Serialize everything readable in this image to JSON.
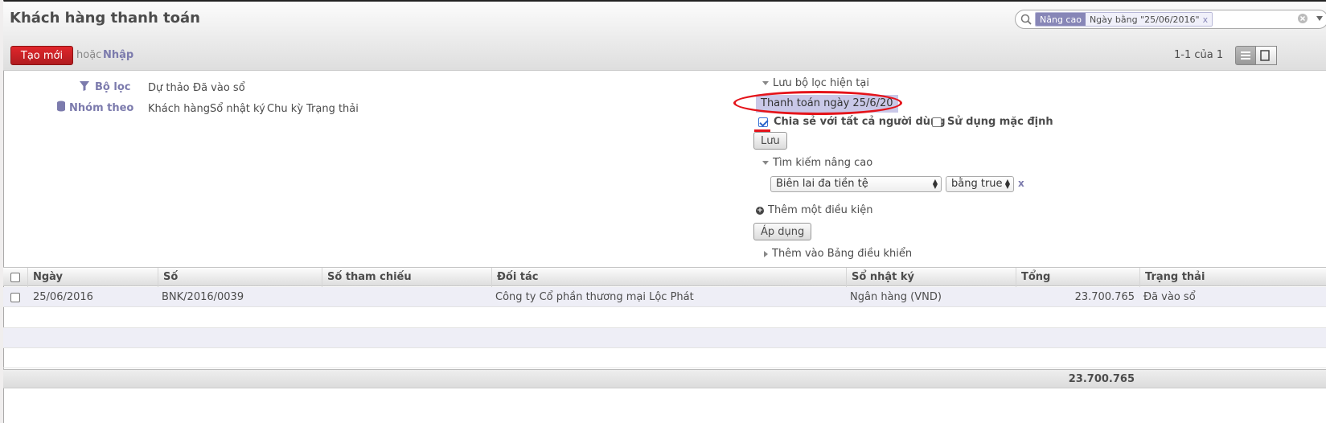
{
  "page": {
    "title": "Khách hàng thanh toán"
  },
  "search": {
    "facet_category": "Nâng cao",
    "facet_value": "Ngày bằng \"25/06/2016\"",
    "facet_remove": "x"
  },
  "toolbar": {
    "create_label": "Tạo mới",
    "or_text": "hoặc",
    "import_label": "Nhập",
    "pager": "1-1 của 1"
  },
  "drawer": {
    "filters_label": "Bộ lọc",
    "filters": [
      "Dự thảo",
      "Đã vào sổ"
    ],
    "groupby_label": "Nhóm theo",
    "groupby": [
      "Khách hàng",
      "Sổ nhật ký",
      "Chu kỳ",
      "Trạng thải"
    ],
    "save_filter_title": "Lưu bộ lọc hiện tại",
    "filter_name_value": "Thanh toán ngày 25/6/20",
    "share_label": "Chia sẻ với tất cả người dùng",
    "share_checked": true,
    "default_label": "Sử dụng mặc định",
    "default_checked": false,
    "save_button": "Lưu",
    "advanced_title": "Tìm kiếm nâng cao",
    "condition_field": "Biên lai đa tiền tệ",
    "condition_operator": "bằng true",
    "condition_remove": "x",
    "add_condition": "Thêm một điều kiện",
    "apply_button": "Áp dụng",
    "add_dashboard": "Thêm vào Bảng điều khiển"
  },
  "table": {
    "columns": [
      "Ngày",
      "Số",
      "Số tham chiếu",
      "Đối tác",
      "Sổ nhật ký",
      "Tổng",
      "Trạng thải"
    ],
    "rows": [
      {
        "date": "25/06/2016",
        "number": "BNK/2016/0039",
        "reference": "",
        "partner": "Công ty Cổ phần thương mại Lộc Phát",
        "journal": "Ngân hàng (VND)",
        "total": "23.700.765",
        "state": "Đã vào sổ"
      }
    ],
    "footer_total": "23.700.765"
  },
  "colors": {
    "accent": "#7c7bad",
    "create_button": "#c4191e",
    "annotation": "#e4141b"
  }
}
